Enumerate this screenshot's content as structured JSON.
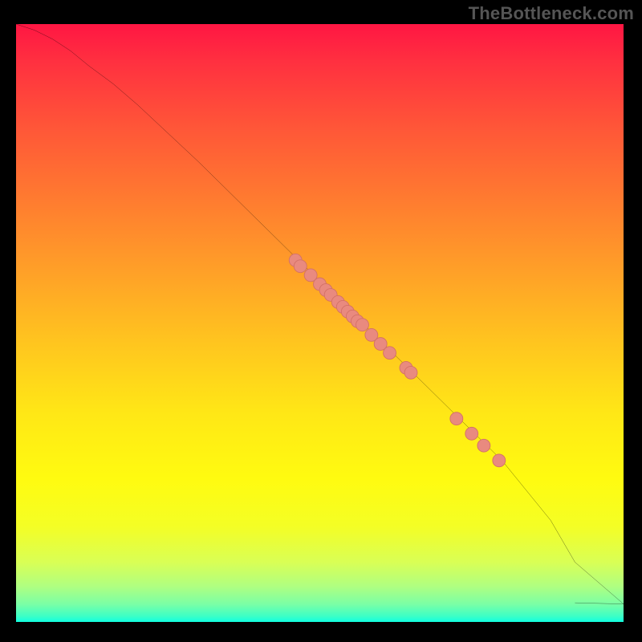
{
  "watermark": "TheBottleneck.com",
  "colors": {
    "line": "#000000",
    "marker_fill": "#e98a7f",
    "marker_stroke": "#d37166"
  },
  "chart_data": {
    "type": "line",
    "title": "",
    "xlabel": "",
    "ylabel": "",
    "xlim": [
      0,
      100
    ],
    "ylim": [
      0,
      100
    ],
    "series": [
      {
        "name": "curve",
        "x": [
          0,
          3,
          6,
          9,
          12,
          16,
          20,
          30,
          40,
          50,
          60,
          70,
          80,
          88,
          92,
          100
        ],
        "y": [
          100,
          99,
          97.5,
          95.5,
          93,
          90,
          86.5,
          77,
          67,
          57,
          47,
          37,
          27,
          17,
          10,
          3
        ]
      },
      {
        "name": "tail",
        "x": [
          92,
          100
        ],
        "y": [
          3.2,
          3.0
        ]
      }
    ],
    "markers": {
      "name": "dots",
      "x": [
        46,
        46.8,
        48.5,
        50,
        51,
        51.8,
        53,
        53.8,
        54.6,
        55.4,
        56.2,
        57.0,
        58.5,
        60.0,
        61.5,
        64.2,
        65.0,
        72.5,
        75.0,
        77.0,
        79.5
      ],
      "y": [
        60.5,
        59.5,
        58.0,
        56.5,
        55.5,
        54.7,
        53.5,
        52.7,
        51.9,
        51.1,
        50.3,
        49.7,
        48.0,
        46.5,
        45.0,
        42.5,
        41.7,
        34.0,
        31.5,
        29.5,
        27.0
      ]
    }
  }
}
